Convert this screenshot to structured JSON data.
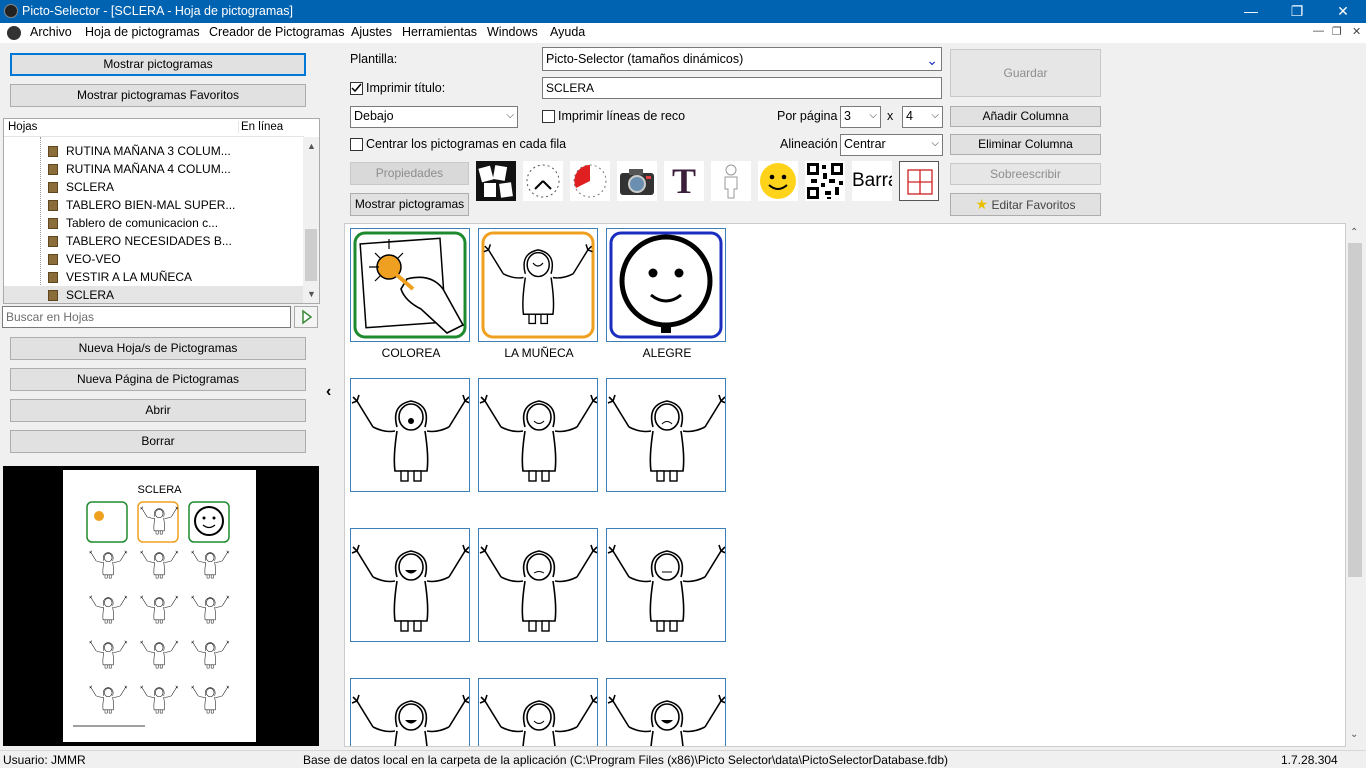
{
  "window": {
    "title": "Picto-Selector - [SCLERA - Hoja de pictogramas]",
    "minimize": "—",
    "restore": "❐",
    "close": "✕"
  },
  "menu": {
    "items": [
      "Archivo",
      "Hoja de pictogramas",
      "Creador de Pictogramas",
      "Ajustes",
      "Herramientas",
      "Windows",
      "Ayuda"
    ]
  },
  "left": {
    "show_pictos": "Mostrar pictogramas",
    "show_favorites": "Mostrar pictogramas Favoritos",
    "tree_header": [
      "Hojas",
      "En línea"
    ],
    "tree_items": [
      "RUTINA MAÑANA 3 COLUM...",
      "RUTINA MAÑANA 4 COLUM...",
      "SCLERA",
      "TABLERO BIEN-MAL SUPER...",
      "Tablero de comunicacion c...",
      "TABLERO NECESIDADES B...",
      "VEO-VEO",
      "VESTIR A LA MUÑECA",
      "SCLERA"
    ],
    "search_placeholder": "Buscar en Hojas",
    "new_sheets": "Nueva Hoja/s de Pictogramas",
    "new_page": "Nueva Página de Pictogramas",
    "open": "Abrir",
    "delete": "Borrar",
    "preview_title": "SCLERA"
  },
  "toolbar": {
    "template_label": "Plantilla:",
    "template_value": "Picto-Selector (tamaños dinámicos)",
    "print_title_label": "Imprimir título:",
    "title_value": "SCLERA",
    "save": "Guardar",
    "position_value": "Debajo",
    "print_lines_label": "Imprimir líneas de reco",
    "per_page_label": "Por página",
    "per_page_cols": "3",
    "per_page_x": "x",
    "per_page_rows": "4",
    "add_column": "Añadir Columna",
    "center_label": "Centrar los pictogramas en cada fila",
    "align_label": "Alineación",
    "align_value": "Centrar",
    "remove_column": "Eliminar Columna",
    "properties": "Propiedades",
    "overwrite": "Sobreescribir",
    "show_pictos": "Mostrar pictogramas",
    "edit_favorites": "Editar Favoritos",
    "icons": [
      "cards-icon",
      "clock-icon",
      "timer-icon",
      "camera-icon",
      "text-t-icon",
      "figure-outline-icon",
      "smiley-icon",
      "qr-code-icon",
      "barcode-text-icon",
      "grid-cell-icon"
    ],
    "bar_label": "Barra",
    "text_t": "T"
  },
  "grid": {
    "captions": [
      "COLOREA",
      "LA MUÑECA",
      "ALEGRE"
    ],
    "colors": {
      "green": "#1e8a2e",
      "orange": "#f0a020",
      "blue": "#1a2fbf",
      "cell_border": "#3c7fb8"
    }
  },
  "status": {
    "user": "Usuario: JMMR",
    "db": "Base de datos local en la carpeta de la aplicación (C:\\Program Files (x86)\\Picto Selector\\data\\PictoSelectorDatabase.fdb)",
    "version": "1.7.28.304"
  }
}
